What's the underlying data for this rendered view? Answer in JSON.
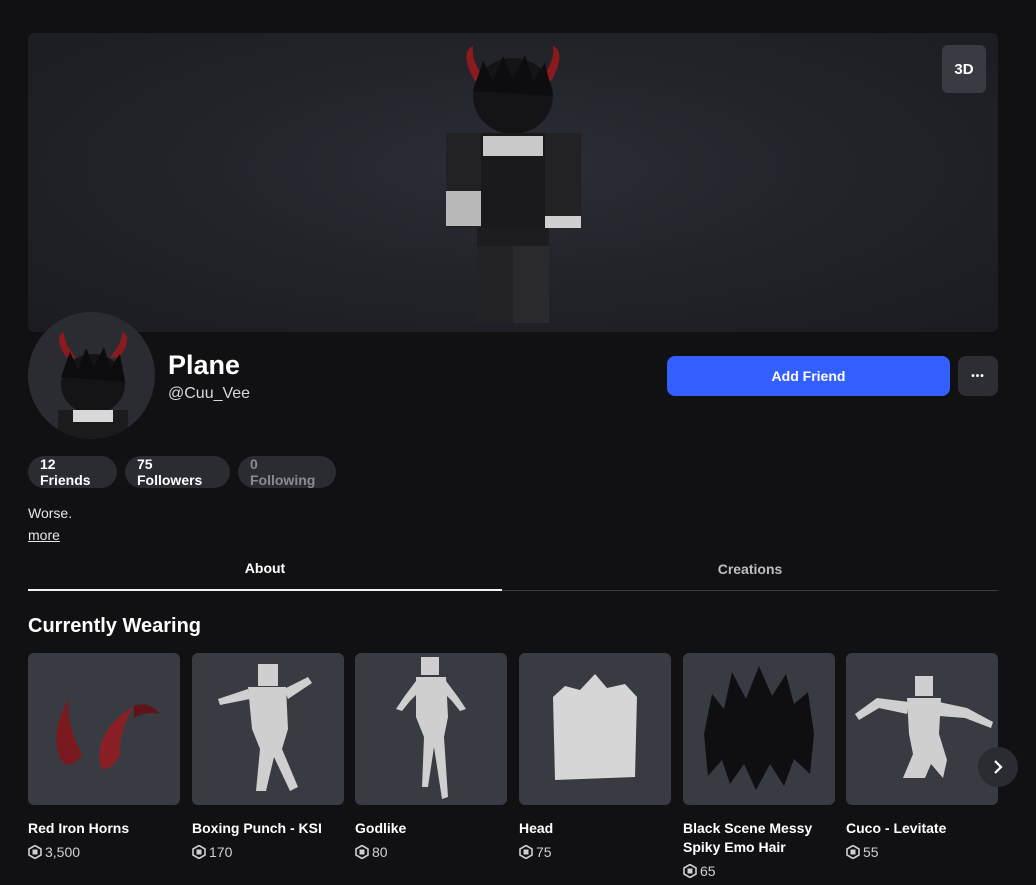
{
  "banner": {
    "toggle_3d_label": "3D"
  },
  "profile": {
    "display_name": "Plane",
    "username": "@Cuu_Vee",
    "add_friend_label": "Add Friend",
    "more_label": "•••"
  },
  "stats": {
    "friends": "12 Friends",
    "followers": "75 Followers",
    "following": "0 Following"
  },
  "bio": {
    "text": "Worse.",
    "more_label": "more"
  },
  "tabs": [
    {
      "label": "About",
      "active": true
    },
    {
      "label": "Creations",
      "active": false
    }
  ],
  "wearing": {
    "title": "Currently Wearing",
    "items": [
      {
        "name": "Red Iron Horns",
        "price": "3,500",
        "icon": "horns"
      },
      {
        "name": "Boxing Punch - KSI",
        "price": "170",
        "icon": "emote-figure"
      },
      {
        "name": "Godlike",
        "price": "80",
        "icon": "emote-figure"
      },
      {
        "name": "Head",
        "price": "75",
        "icon": "head"
      },
      {
        "name": "Black Scene Messy Spiky Emo Hair",
        "price": "65",
        "icon": "hair"
      },
      {
        "name": "Cuco - Levitate",
        "price": "55",
        "icon": "emote-figure"
      }
    ]
  },
  "colors": {
    "accent": "#335fff",
    "background": "#111114",
    "card": "#393b43"
  }
}
